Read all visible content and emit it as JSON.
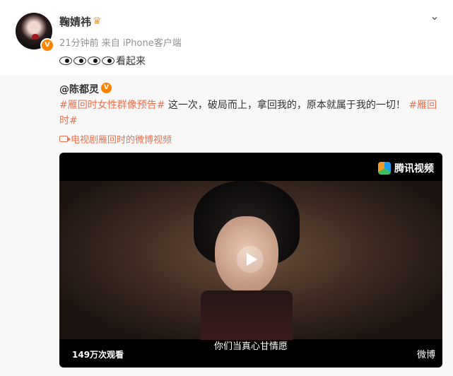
{
  "post": {
    "username": "鞠婧祎",
    "time": "21分钟前",
    "source": "来自 iPhone客户端",
    "text": "看起来"
  },
  "repost": {
    "author": "@陈都灵",
    "hashtag1": "#雁回时女性群像预告#",
    "body": " 这一次，破局而上，拿回我的，原本就属于我的一切！",
    "hashtag2": "#雁回时#",
    "video_link": "电视剧雁回时的微博视频"
  },
  "video": {
    "brand": "腾讯视频",
    "view_count": "149万次观看",
    "subtitle": "你们当真心甘情愿",
    "watermark": "微博"
  },
  "icons": [
    "crown-icon",
    "verified-icon",
    "chevron-down-icon",
    "eyes-emoji",
    "video-icon",
    "play-icon",
    "tencent-video-icon"
  ]
}
